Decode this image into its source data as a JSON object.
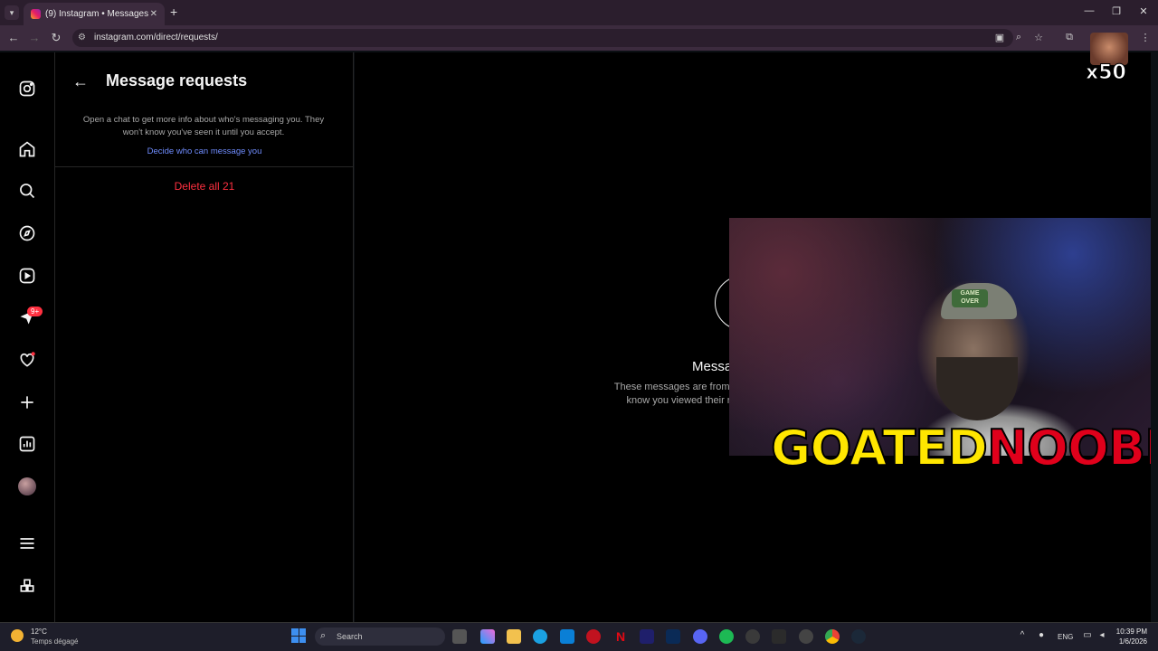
{
  "browser": {
    "tab_title": "(9) Instagram • Messages",
    "url": "instagram.com/direct/requests/"
  },
  "sidebar": {
    "messages_badge": "9+"
  },
  "requests": {
    "title": "Message requests",
    "info_text": "Open a chat to get more info about who's messaging you. They won't know you've seen it until you accept.",
    "decide_link": "Decide who can message you",
    "delete_all": "Delete all 21"
  },
  "main": {
    "title": "Messa",
    "desc_line1": "These messages are from people y",
    "desc_line2": "know you viewed their reques"
  },
  "overlay": {
    "brand_part1": "GOATED",
    "brand_part2": "NOOBIE",
    "cap_text": "GAME OVER",
    "multiplier": "x50"
  },
  "taskbar": {
    "temperature": "12°C",
    "weather": "Temps dégagé",
    "search_placeholder": "Search",
    "language": "ENG",
    "time": "10:39 PM",
    "date": "1/6/2026"
  },
  "colors": {
    "accent_link": "#708dff",
    "danger": "#ff3040",
    "brand_yellow": "#ffe600",
    "brand_red": "#e0001b"
  }
}
